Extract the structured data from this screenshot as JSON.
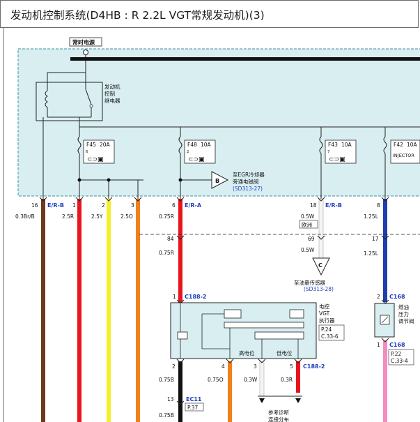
{
  "title": "发动机控制系统(D4HB : R 2.2L VGT常规发动机)(3)",
  "power_label": "常时电源",
  "relay": {
    "line1": "发动机",
    "line2": "控制",
    "line3": "继电器"
  },
  "fuses": [
    {
      "id": "F45",
      "rating": "20A",
      "num": "6"
    },
    {
      "id": "F48",
      "rating": "10A",
      "num": "2"
    },
    {
      "id": "F43",
      "rating": "10A",
      "num": "7"
    },
    {
      "id": "F42",
      "rating": "10A",
      "name": "INJECTOR"
    }
  ],
  "conn_b": {
    "letter": "B",
    "line1": "至EGR冷却器",
    "line2": "旁通电磁阀",
    "ref": "(SD313-27)"
  },
  "conn_c": {
    "letter": "C",
    "line1": "至油量传感器",
    "ref": "(SD313-28)"
  },
  "pins": {
    "p16": "16",
    "c16": "E/R-B",
    "w16": "0.3Br/B",
    "p1": "1",
    "w1": "2.5R",
    "p2": "2",
    "w2": "2.5Y",
    "p3": "3",
    "w3": "2.5O",
    "p6": "6",
    "c6": "E/R-A",
    "w6": "0.75R",
    "p84": "84",
    "w84": "0.75R",
    "p18": "18",
    "c18": "E/R-B",
    "w18": "0.5W",
    "region": "欧洲",
    "p69": "69",
    "w69": "0.5W",
    "p8": "8",
    "w8": "1.25L",
    "p17": "17",
    "w17": "1.25L"
  },
  "actuator": {
    "pin": "1",
    "conn": "C188-2",
    "name1": "电控",
    "name2": "VGT",
    "name3": "执行器",
    "ref1": "P.24",
    "ref2": "C.33-6",
    "high": "高电位",
    "low": "低电位",
    "out_conn": "C188-2"
  },
  "bottom": {
    "p2": "2",
    "w2": "0.75B",
    "p4": "4",
    "w4": "0.75O",
    "p3": "3",
    "w3": "0.3W",
    "p5": "5",
    "w5": "0.3R",
    "p13": "13",
    "c13": "EC11",
    "ref13": "P.37",
    "w13": "0.75B",
    "diag1": "参考诊断",
    "diag2": "连接分布"
  },
  "fuel_valve": {
    "pin": "2",
    "conn": "C168",
    "name1": "燃油",
    "name2": "压力",
    "name3": "调节阀",
    "out_pin": "1",
    "out_conn": "C168",
    "ref1": "P.22",
    "ref2": "C.33-4"
  },
  "colors": {
    "box_fill": "#d8eef1",
    "box_stroke": "#3d8fa0",
    "brown": "#6b3a1f",
    "red": "#e8141c",
    "yellow": "#f4ef2a",
    "orange": "#f0801a",
    "white": "#f4f4f4",
    "blue": "#1f3fae",
    "black": "#111111",
    "pink": "#f58cbf",
    "gray": "#999999"
  }
}
